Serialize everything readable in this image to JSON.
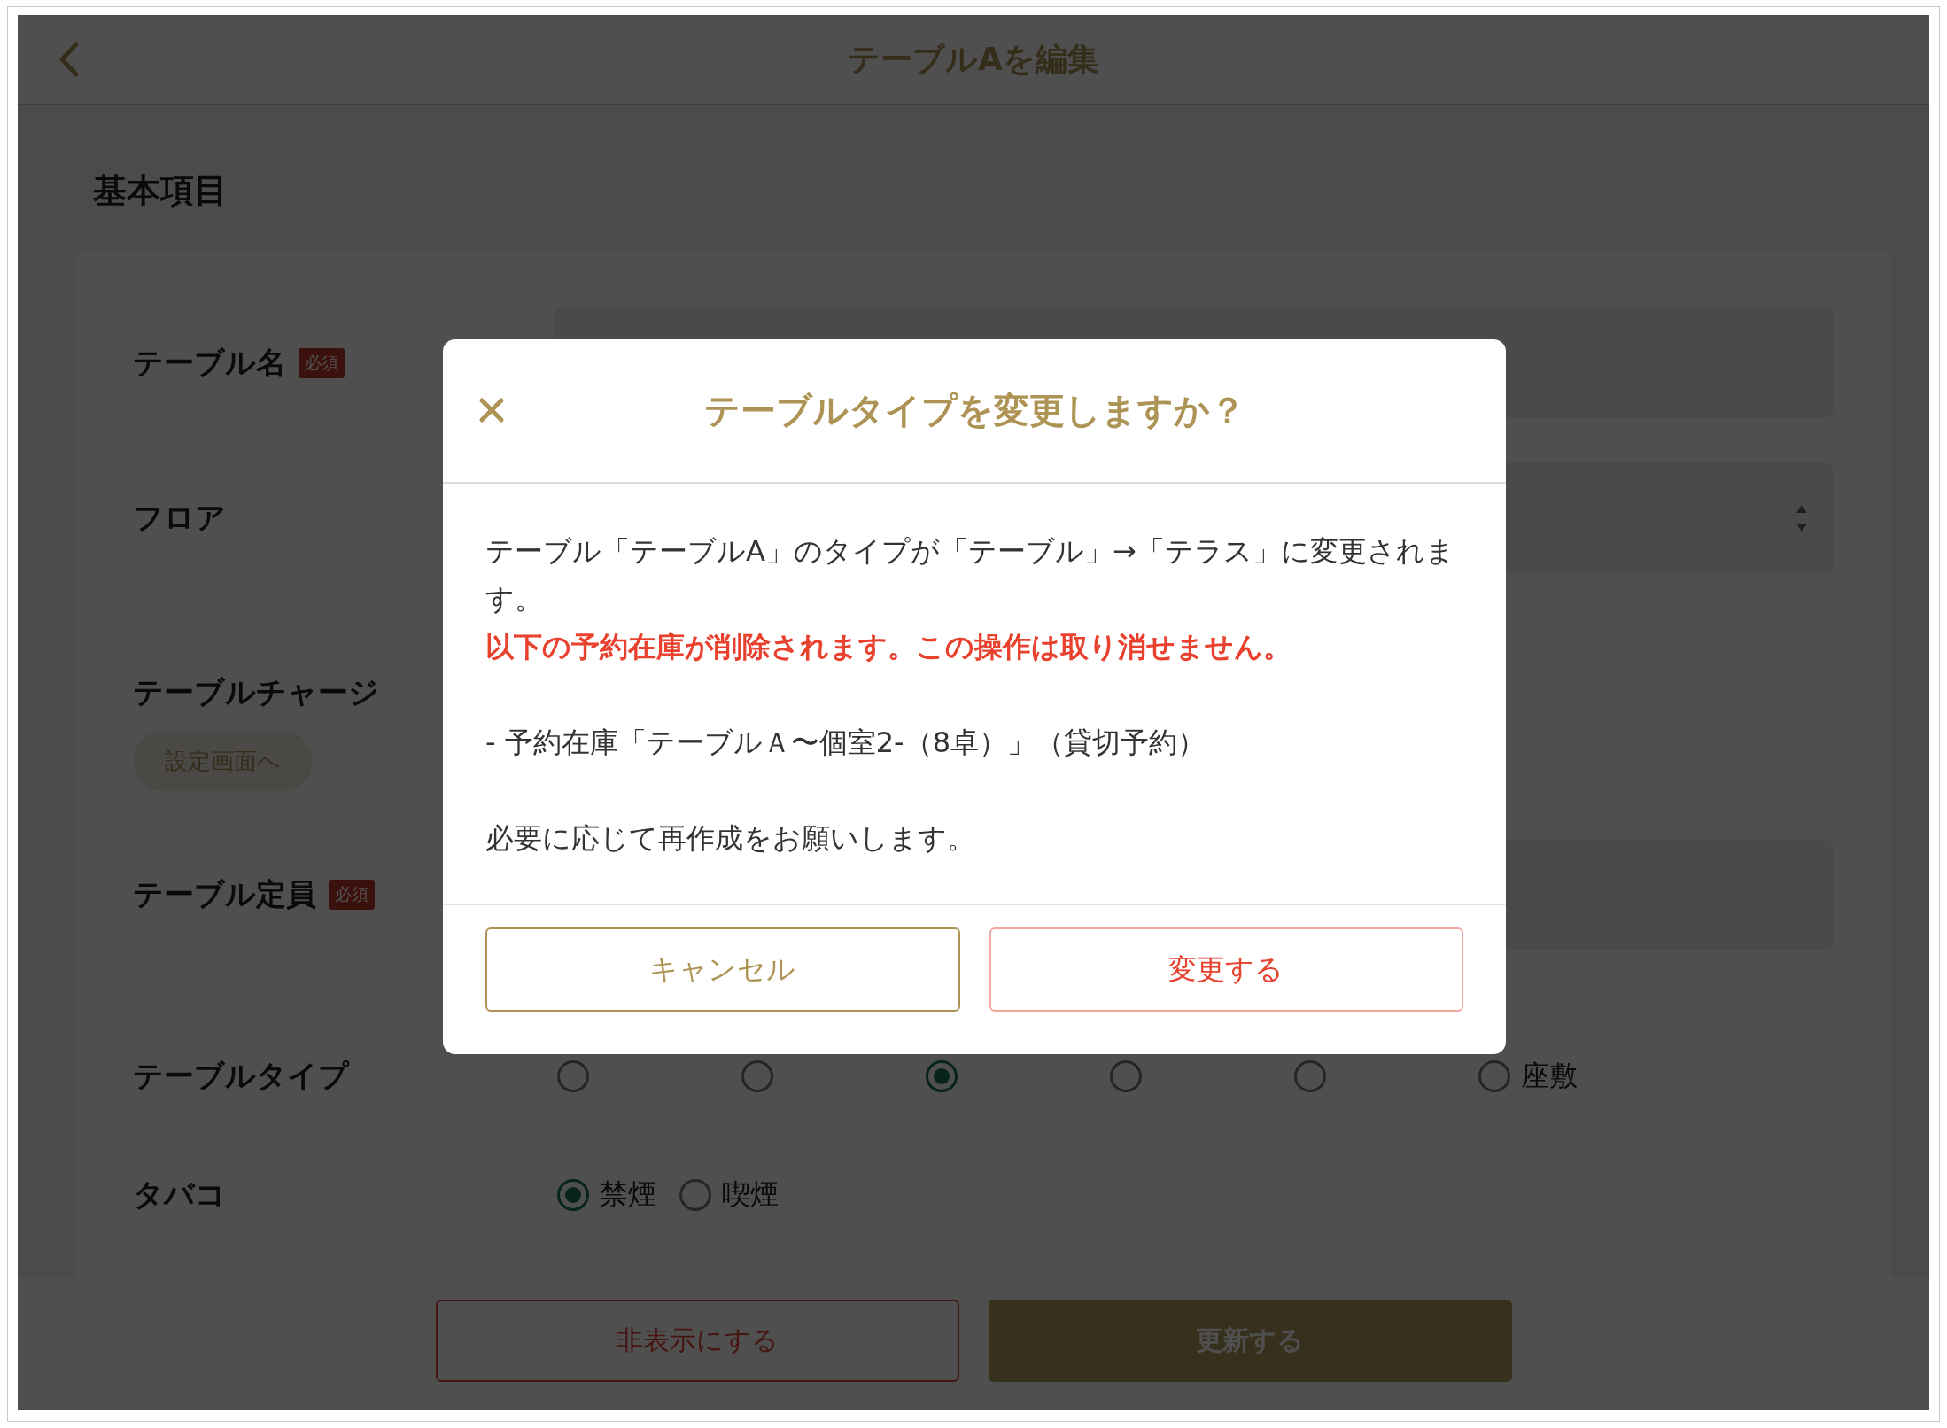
{
  "header": {
    "title": "テーブルAを編集"
  },
  "section_title": "基本項目",
  "form": {
    "fields": [
      {
        "kind": "text",
        "label": "テーブル名",
        "badge": "必須"
      },
      {
        "kind": "select",
        "label": "フロア"
      },
      {
        "kind": "link",
        "label": "テーブルチャージ",
        "link": "設定画面へ"
      },
      {
        "kind": "text",
        "label": "テーブル定員",
        "badge": "必須"
      },
      {
        "kind": "radio",
        "label": "テーブルタイプ",
        "options": [
          {
            "selected": false
          },
          {
            "selected": false
          },
          {
            "selected": true
          },
          {
            "selected": false
          },
          {
            "selected": false
          },
          {
            "label": "座敷",
            "selected": false
          }
        ]
      },
      {
        "kind": "radio",
        "label": "タバコ",
        "options": [
          {
            "label": "禁煙",
            "selected": true
          },
          {
            "label": "喫煙",
            "selected": false
          }
        ]
      }
    ]
  },
  "footer": {
    "buttons": [
      {
        "label": "非表示にする",
        "kind": "outline"
      },
      {
        "label": "更新する",
        "kind": "primary"
      }
    ]
  },
  "dialog": {
    "title": "テーブルタイプを変更しますか？",
    "blocks": [
      {
        "lines": [
          {
            "kind": "normal",
            "text": "テーブル「テーブルA」のタイプが「テーブル」→「テラス」に変更されます。"
          },
          {
            "kind": "warning",
            "text": "以下の予約在庫が削除されます。この操作は取り消せません。"
          }
        ]
      },
      {
        "lines": [
          {
            "kind": "normal",
            "text": "- 予約在庫「テーブルＡ〜個室2-（8卓）」（貸切予約）"
          }
        ]
      },
      {
        "lines": [
          {
            "kind": "normal",
            "text": "必要に応じて再作成をお願いします。"
          }
        ]
      }
    ],
    "buttons": [
      {
        "label": "キャンセル",
        "kind": "cancel"
      },
      {
        "label": "変更する",
        "kind": "danger"
      }
    ]
  }
}
